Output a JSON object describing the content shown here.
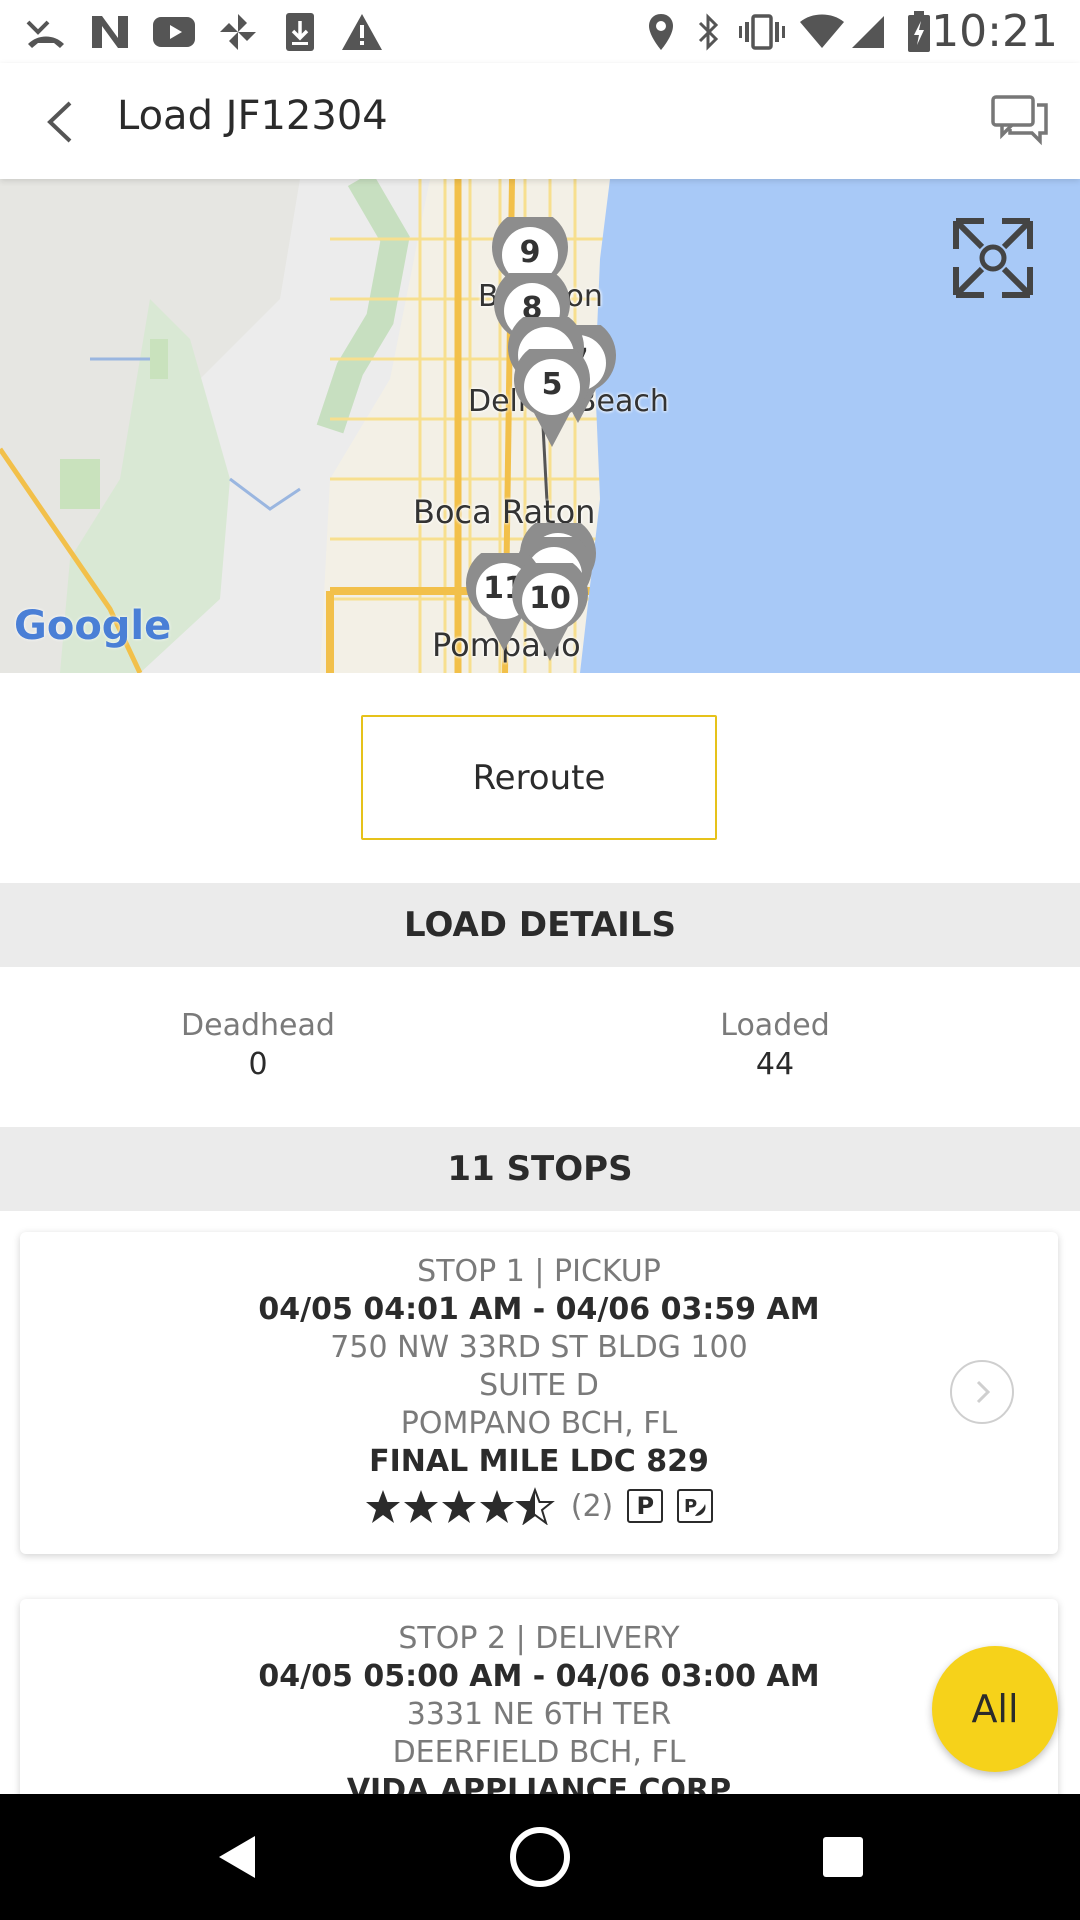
{
  "status_bar": {
    "time": "10:21",
    "icons": [
      "missed-call-icon",
      "n-logo-icon",
      "youtube-icon",
      "pinwheel-icon",
      "download-icon",
      "warning-icon",
      "location-icon",
      "bluetooth-icon",
      "vibrate-icon",
      "wifi-icon",
      "signal-icon",
      "battery-icon"
    ]
  },
  "app_bar": {
    "title": "Load JF12304"
  },
  "map": {
    "labels": {
      "delray": "Delray Beach",
      "boynton": "Boynton",
      "boca": "Boca Raton",
      "pompano": "Pompano"
    },
    "markers": [
      "9",
      "8",
      "7",
      "5",
      "11",
      "10"
    ],
    "google": "Google"
  },
  "reroute_label": "Reroute",
  "load_details": {
    "header": "LOAD DETAILS",
    "deadhead_label": "Deadhead",
    "deadhead_value": "0",
    "loaded_label": "Loaded",
    "loaded_value": "44"
  },
  "stops_header": "11 STOPS",
  "stops": [
    {
      "title": "STOP 1 | PICKUP",
      "window": "04/05 04:01 AM - 04/06 03:59 AM",
      "address1": "750 NW 33RD ST  BLDG 100",
      "address2": "SUITE D",
      "city": "POMPANO BCH, FL",
      "company": "FINAL MILE LDC 829",
      "rating": 4.5,
      "rating_count": "(2)",
      "badge_parking": "P"
    },
    {
      "title": "STOP 2 | DELIVERY",
      "window": "04/05 05:00 AM - 04/06 03:00 AM",
      "address1": "3331 NE 6TH TER",
      "city": "DEERFIELD BCH, FL",
      "company": "VIDA APPLIANCE CORP"
    }
  ],
  "fab_label": "All",
  "colors": {
    "accent": "#f6d21a",
    "accent_border": "#e6c21a",
    "ocean": "#a8c9f7",
    "section_bg": "#ebebeb"
  }
}
